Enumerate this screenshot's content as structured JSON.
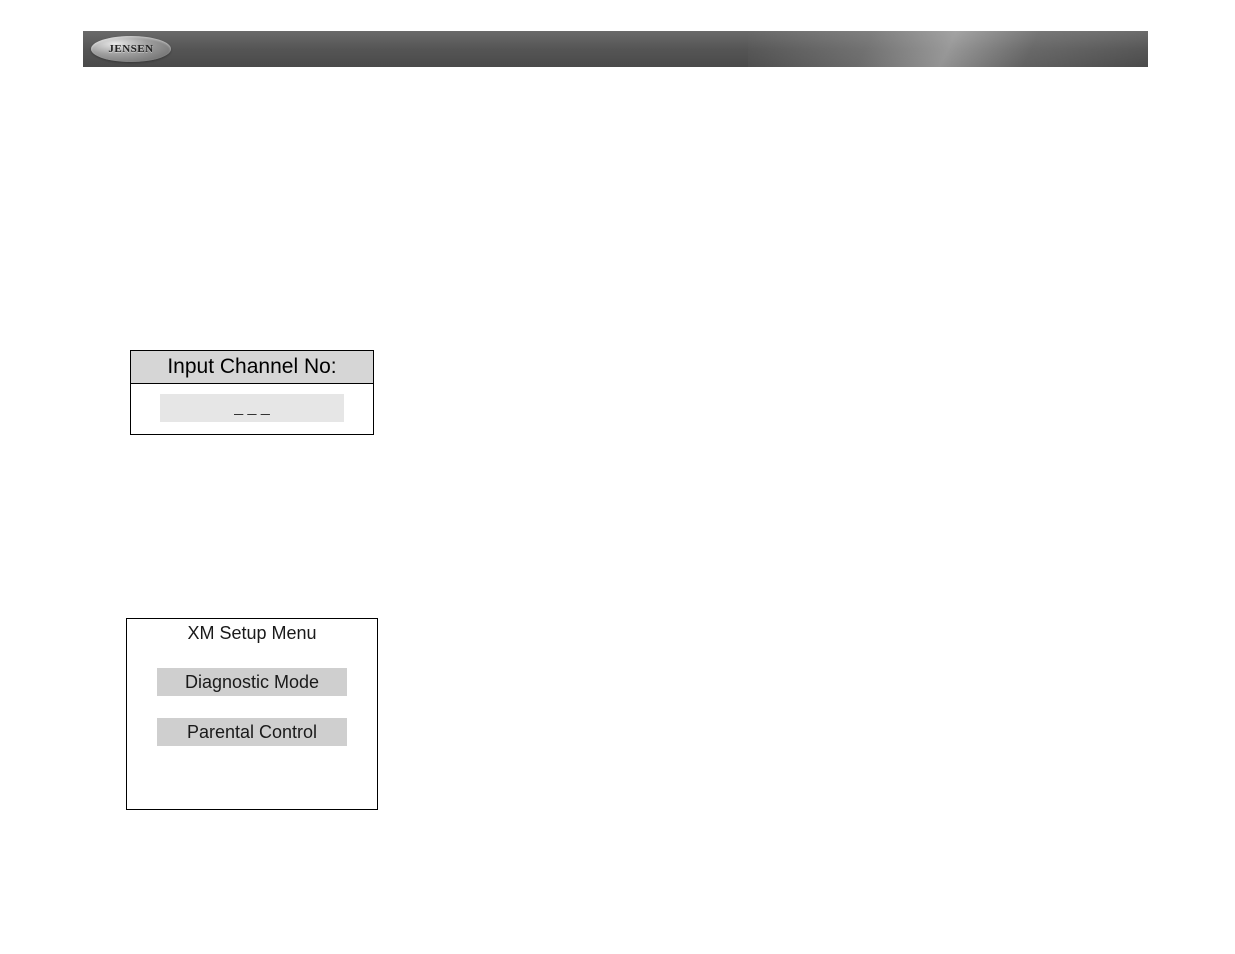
{
  "header": {
    "brand": "JENSEN"
  },
  "input_channel": {
    "title": "Input Channel No:",
    "value": "_ _ _"
  },
  "setup_menu": {
    "title": "XM Setup Menu",
    "items": [
      {
        "label": "Diagnostic Mode"
      },
      {
        "label": "Parental Control"
      }
    ]
  }
}
